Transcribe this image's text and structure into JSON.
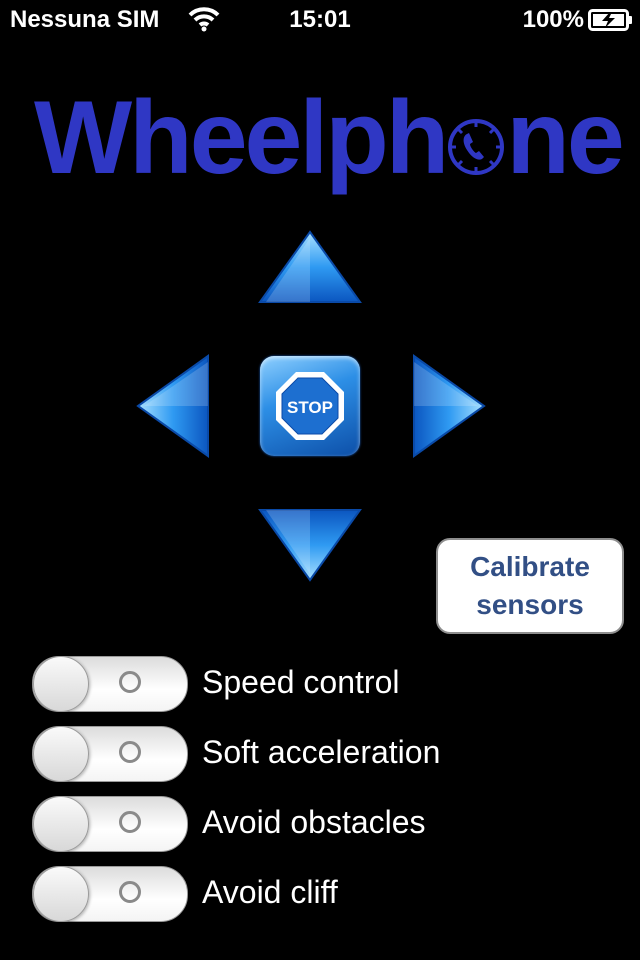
{
  "status_bar": {
    "carrier": "Nessuna SIM",
    "time": "15:01",
    "battery_percent": "100%",
    "wifi_icon": "wifi-icon",
    "battery_icon": "battery-charging-icon"
  },
  "app": {
    "logo_text_left": "Wheelph",
    "logo_text_right": "ne",
    "logo_dial_icon": "phone-dial-icon",
    "brand_color": "#2f37c4"
  },
  "controls": {
    "stop_label": "STOP",
    "arrow_color": "#1e88f0",
    "calibrate": {
      "line1": "Calibrate",
      "line2": "sensors",
      "text_color": "#324f85"
    }
  },
  "toggles": [
    {
      "label": "Speed control",
      "state": "off"
    },
    {
      "label": "Soft acceleration",
      "state": "off"
    },
    {
      "label": "Avoid obstacles",
      "state": "off"
    },
    {
      "label": "Avoid cliff",
      "state": "off"
    }
  ]
}
